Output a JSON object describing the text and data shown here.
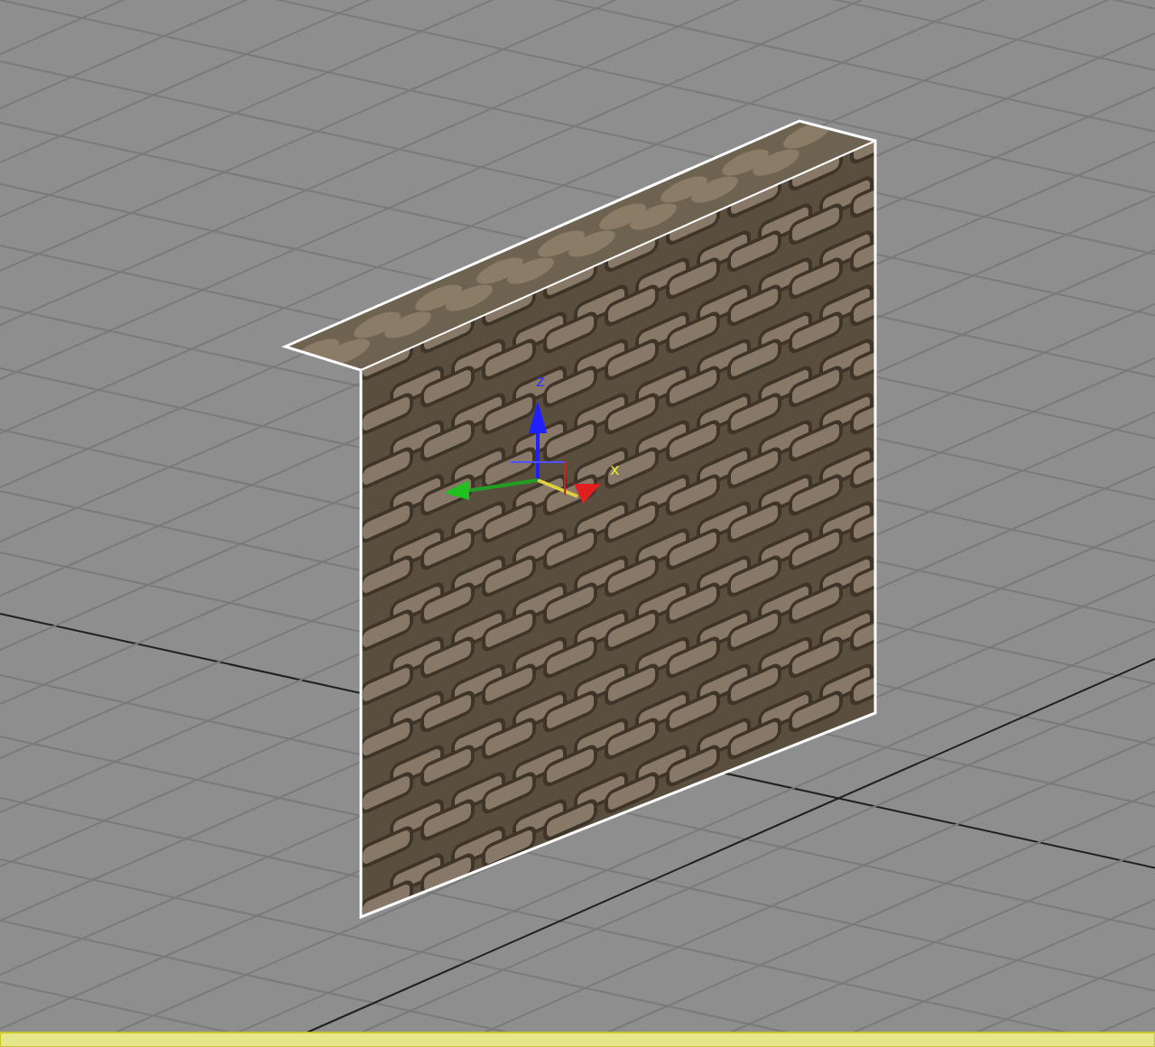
{
  "viewport": {
    "gizmo_labels": [
      {
        "kind": "z",
        "text": "z"
      },
      {
        "kind": "x",
        "text": "x"
      }
    ]
  }
}
